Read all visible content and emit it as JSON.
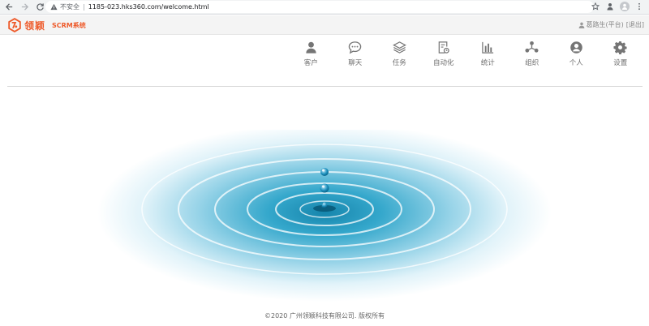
{
  "browser": {
    "security_label": "不安全",
    "url": "1185-023.hks360.com/welcome.html"
  },
  "brand": {
    "name_cn": "领颖",
    "product": "SCRM系统",
    "color": "#ee5a2a"
  },
  "user": {
    "name": "葛路生(平台)",
    "logout_label": "[退出]"
  },
  "nav": {
    "items": [
      {
        "label": "客户",
        "icon": "user-icon"
      },
      {
        "label": "聊天",
        "icon": "chat-icon"
      },
      {
        "label": "任务",
        "icon": "layers-icon"
      },
      {
        "label": "自动化",
        "icon": "automation-icon"
      },
      {
        "label": "统计",
        "icon": "bar-chart-icon"
      },
      {
        "label": "组织",
        "icon": "org-icon"
      },
      {
        "label": "个人",
        "icon": "person-circle-icon"
      },
      {
        "label": "设置",
        "icon": "gear-icon"
      }
    ]
  },
  "footer": {
    "copyright": "©2020 广州领颖科技有限公司. 版权所有"
  }
}
